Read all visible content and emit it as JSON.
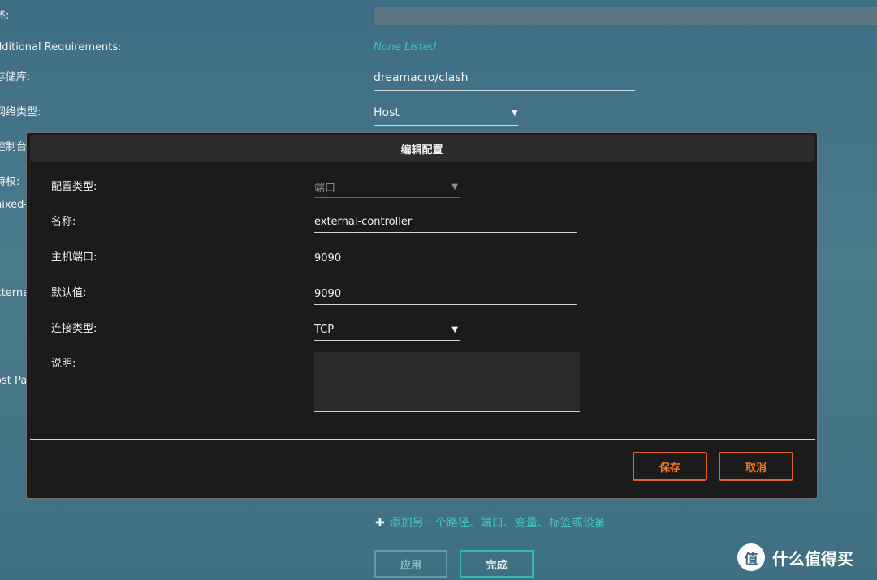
{
  "background_form": {
    "labels": [
      "述:",
      "dditional Requirements:",
      "存储库:",
      "网络类型:",
      "控制台",
      "特权:",
      "nixed-",
      "xterna",
      "ost Pa"
    ],
    "requirements_value": "None Listed",
    "repository_value": "dreamacro/clash",
    "network_type_value": "Host",
    "add_link": "添加另一个路径、端口、变量、标签或设备",
    "apply_button": "应用",
    "done_button": "完成"
  },
  "modal": {
    "title": "编辑配置",
    "fields": {
      "config_type_label": "配置类型:",
      "config_type_value": "端口",
      "name_label": "名称:",
      "name_value": "external-controller",
      "host_port_label": "主机端口:",
      "host_port_value": "9090",
      "default_label": "默认值:",
      "default_value": "9090",
      "connection_type_label": "连接类型:",
      "connection_type_value": "TCP",
      "description_label": "说明:",
      "description_value": ""
    },
    "save_button": "保存",
    "cancel_button": "取消"
  },
  "watermark": {
    "logo_char": "值",
    "text": "什么值得买"
  },
  "colors": {
    "accent_teal": "#3ec6c1",
    "button_orange": "#e7602b",
    "modal_bg": "#1b1b1b"
  },
  "icons": [
    "dropdown-arrow-icon",
    "plus-icon"
  ]
}
